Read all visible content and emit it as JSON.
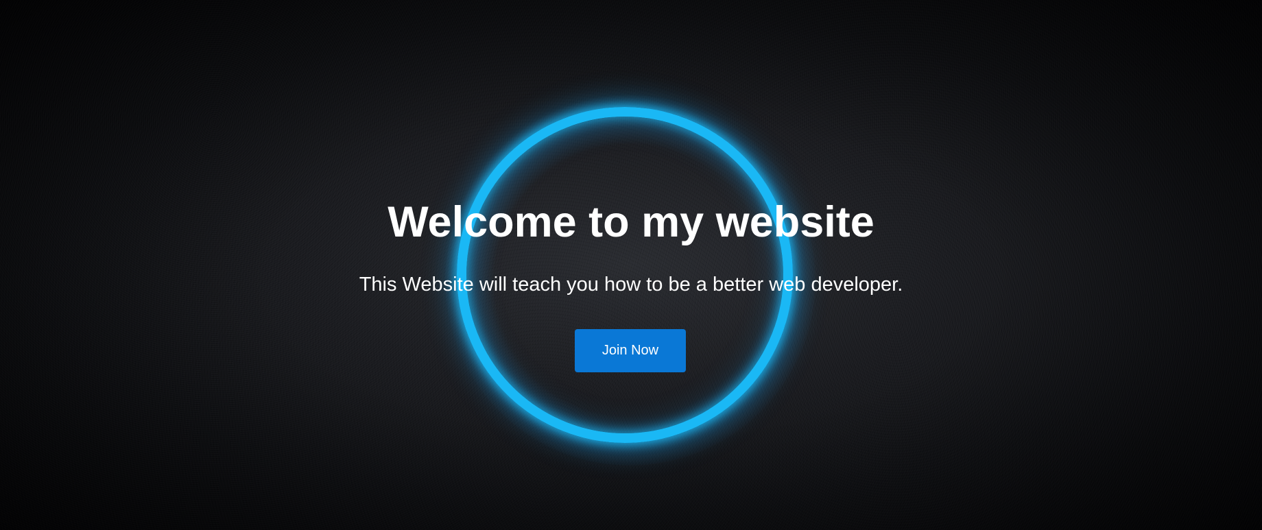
{
  "hero": {
    "title": "Welcome to my website",
    "subtitle": "This Website will teach you how to be a better web developer.",
    "cta_label": "Join Now",
    "background_icon": "glowing-ring",
    "colors": {
      "ring": "#1ab8f5",
      "button": "#0a78d6",
      "text": "#ffffff",
      "background": "#101114"
    }
  }
}
